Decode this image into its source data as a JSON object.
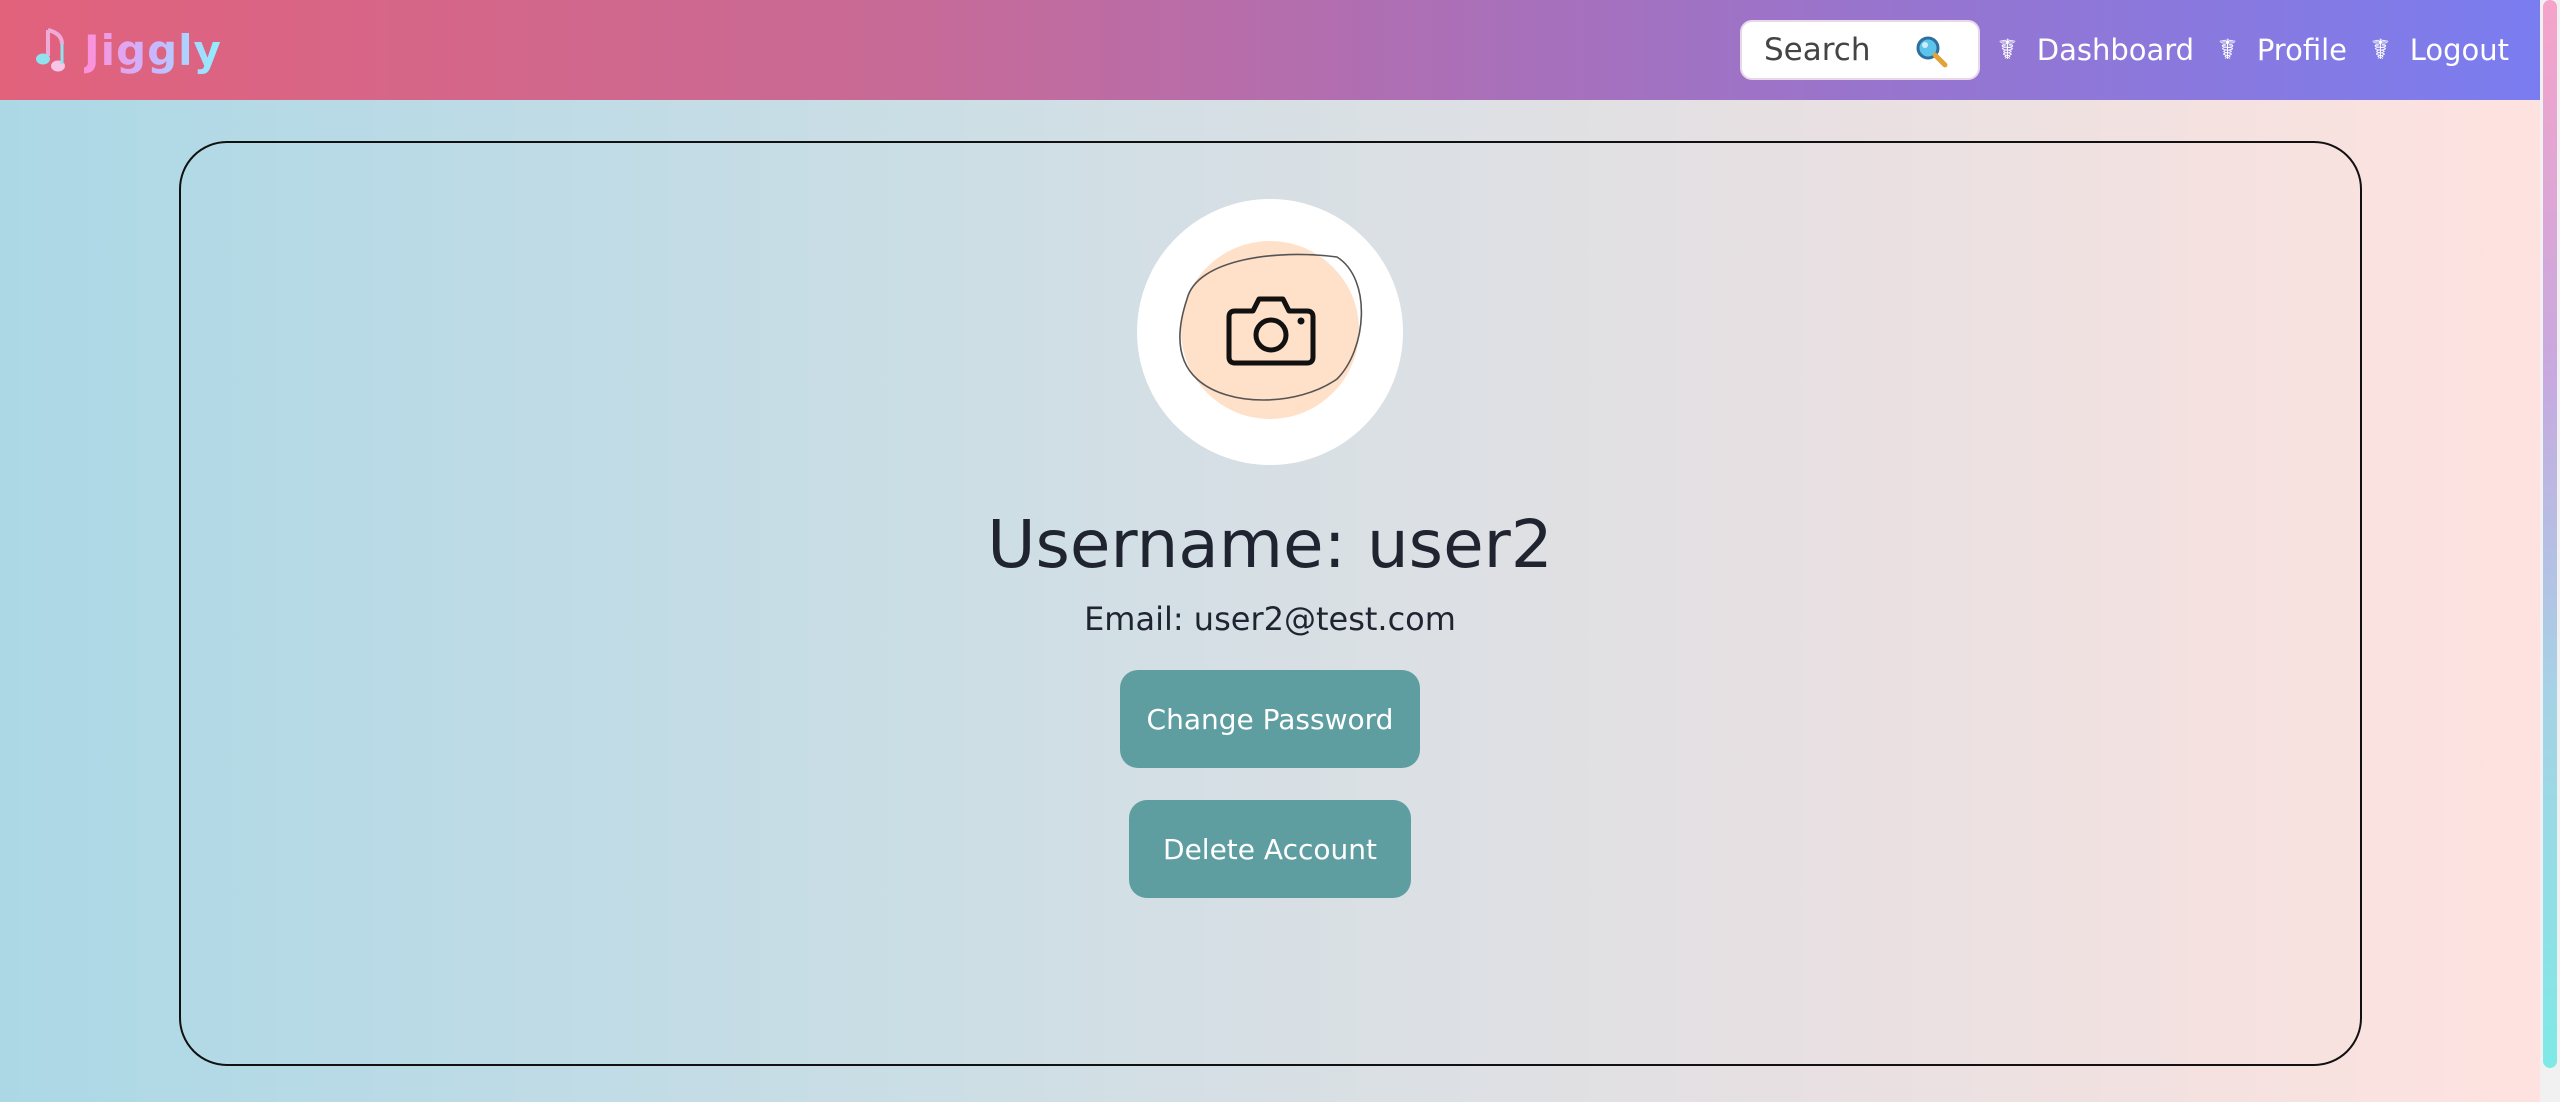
{
  "brand": {
    "name": "Jiggly",
    "icon": "music-note-icon"
  },
  "nav": {
    "search_placeholder": "Search",
    "search_icon": "magnifier-icon",
    "links": [
      {
        "glyph": "☤",
        "label": "Dashboard"
      },
      {
        "glyph": "☤",
        "label": "Profile"
      },
      {
        "glyph": "☤",
        "label": "Logout"
      }
    ]
  },
  "profile": {
    "avatar_icon": "camera-icon",
    "username": "Username: user2",
    "email": "Email: user2@test.com",
    "change_password_label": "Change Password",
    "delete_account_label": "Delete Account"
  },
  "colors": {
    "navbar_start": "#e2627c",
    "navbar_end": "#7a7df0",
    "button": "#5f9ea0",
    "avatar_fill": "#ffe0c8",
    "page_start": "#acd8e6",
    "page_end": "#ffe2df"
  }
}
